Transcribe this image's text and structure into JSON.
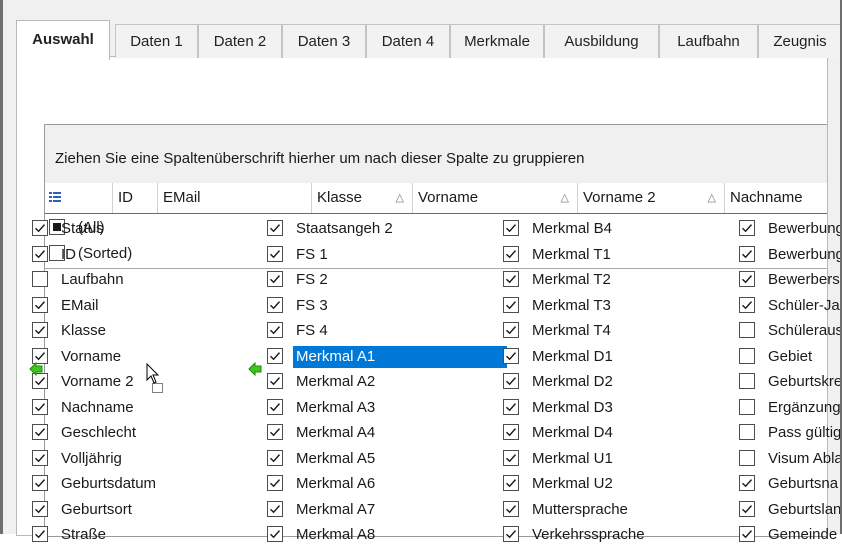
{
  "tabs": [
    "Auswahl",
    "Daten 1",
    "Daten 2",
    "Daten 3",
    "Daten 4",
    "Merkmale",
    "Ausbildung",
    "Laufbahn",
    "Zeugnis"
  ],
  "active_tab": "Auswahl",
  "group_by_hint": "Ziehen Sie eine Spaltenüberschrift hierher um nach dieser Spalte zu gruppieren",
  "header": {
    "columns": [
      "ID",
      "EMail",
      "Klasse",
      "Vorname",
      "Vorname 2",
      "Nachname"
    ]
  },
  "chooser": {
    "all_label": "(All)",
    "sorted_label": "(Sorted)",
    "selected_item": "Merkmal A1",
    "columns": [
      [
        {
          "label": "Status",
          "checked": true
        },
        {
          "label": "ID",
          "checked": true
        },
        {
          "label": "Laufbahn",
          "checked": false
        },
        {
          "label": "EMail",
          "checked": true
        },
        {
          "label": "Klasse",
          "checked": true
        },
        {
          "label": "Vorname",
          "checked": true
        },
        {
          "label": "Vorname 2",
          "checked": true
        },
        {
          "label": "Nachname",
          "checked": true
        },
        {
          "label": "Geschlecht",
          "checked": true
        },
        {
          "label": "Volljährig",
          "checked": true
        },
        {
          "label": "Geburtsdatum",
          "checked": true
        },
        {
          "label": "Geburtsort",
          "checked": true
        },
        {
          "label": "Straße",
          "checked": true
        }
      ],
      [
        {
          "label": "Staatsangeh 2",
          "checked": true
        },
        {
          "label": "FS 1",
          "checked": true
        },
        {
          "label": "FS 2",
          "checked": true
        },
        {
          "label": "FS 3",
          "checked": true
        },
        {
          "label": "FS 4",
          "checked": true
        },
        {
          "label": "Merkmal A1",
          "checked": true
        },
        {
          "label": "Merkmal A2",
          "checked": true
        },
        {
          "label": "Merkmal A3",
          "checked": true
        },
        {
          "label": "Merkmal A4",
          "checked": true
        },
        {
          "label": "Merkmal A5",
          "checked": true
        },
        {
          "label": "Merkmal A6",
          "checked": true
        },
        {
          "label": "Merkmal A7",
          "checked": true
        },
        {
          "label": "Merkmal A8",
          "checked": true
        }
      ],
      [
        {
          "label": "Merkmal B4",
          "checked": true
        },
        {
          "label": "Merkmal T1",
          "checked": true
        },
        {
          "label": "Merkmal T2",
          "checked": true
        },
        {
          "label": "Merkmal T3",
          "checked": true
        },
        {
          "label": "Merkmal T4",
          "checked": true
        },
        {
          "label": "Merkmal D1",
          "checked": true
        },
        {
          "label": "Merkmal D2",
          "checked": true
        },
        {
          "label": "Merkmal D3",
          "checked": true
        },
        {
          "label": "Merkmal D4",
          "checked": true
        },
        {
          "label": "Merkmal U1",
          "checked": true
        },
        {
          "label": "Merkmal U2",
          "checked": true
        },
        {
          "label": "Muttersprache",
          "checked": true
        },
        {
          "label": "Verkehrssprache",
          "checked": true
        }
      ],
      [
        {
          "label": "Bewerbung",
          "checked": true
        },
        {
          "label": "Bewerbung",
          "checked": true
        },
        {
          "label": "Bewerbers",
          "checked": true
        },
        {
          "label": "Schüler-Ja",
          "checked": true
        },
        {
          "label": "Schüleraus",
          "checked": false
        },
        {
          "label": "Gebiet",
          "checked": false
        },
        {
          "label": "Geburtskre",
          "checked": false
        },
        {
          "label": "Ergänzung",
          "checked": false
        },
        {
          "label": "Pass gültig",
          "checked": false
        },
        {
          "label": "Visum Abla",
          "checked": false
        },
        {
          "label": "Geburtsna",
          "checked": true
        },
        {
          "label": "Geburtslan",
          "checked": true
        },
        {
          "label": "Gemeinde",
          "checked": true
        }
      ]
    ]
  },
  "icons": {
    "column_chooser": "column-chooser-icon",
    "sort": "sort-ascending-icon",
    "drag_marker": "drag-arrow-icon",
    "cursor": "drag-cursor-icon"
  },
  "colors": {
    "selection": "#0078d7",
    "drag_arrow": "#3cc81e"
  }
}
